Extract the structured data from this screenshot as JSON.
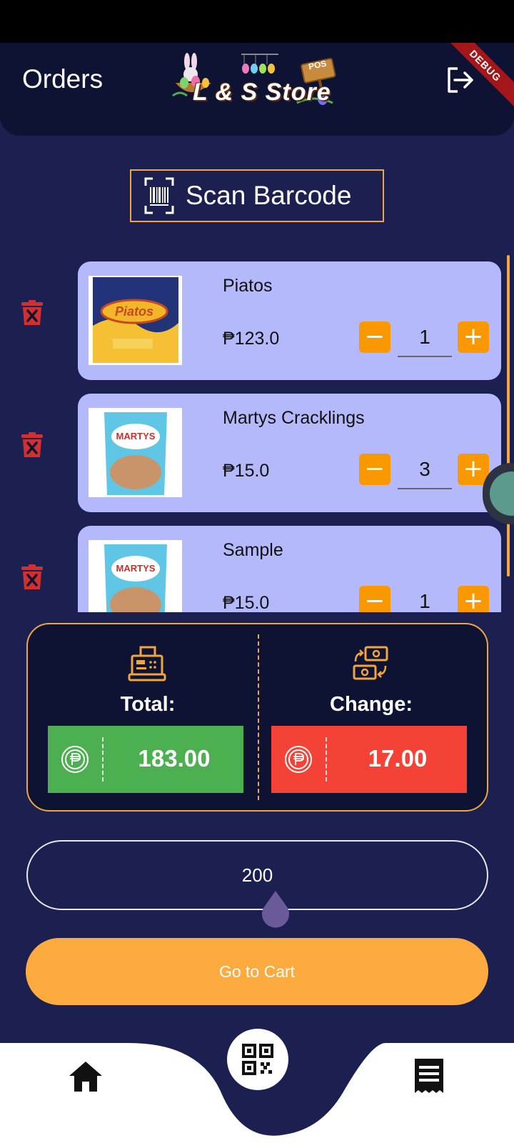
{
  "header": {
    "title": "Orders",
    "logo_text": "L & S Store",
    "logo_badge": "POS",
    "debug_banner": "DEBUG"
  },
  "scan": {
    "label": "Scan Barcode"
  },
  "items": [
    {
      "name": "Piatos",
      "price": "₱123.0",
      "qty": "1"
    },
    {
      "name": "Martys Cracklings",
      "price": "₱15.0",
      "qty": "3"
    },
    {
      "name": "Sample",
      "price": "₱15.0",
      "qty": "1"
    }
  ],
  "summary": {
    "total_label": "Total:",
    "total_value": "183.00",
    "change_label": "Change:",
    "change_value": "17.00"
  },
  "cash_input": {
    "value": "200"
  },
  "cart_button": {
    "label": "Go to Cart"
  },
  "colors": {
    "background": "#1b2050",
    "accent": "#f0a63c",
    "card": "#b4b9fc",
    "total_green": "#4caf50",
    "change_red": "#f44336"
  },
  "icons": [
    "barcode-scan-icon",
    "logout-icon",
    "trash-icon",
    "minus-icon",
    "plus-icon",
    "cash-register-icon",
    "money-exchange-icon",
    "peso-coin-icon",
    "home-icon",
    "qr-code-icon",
    "receipt-icon"
  ]
}
